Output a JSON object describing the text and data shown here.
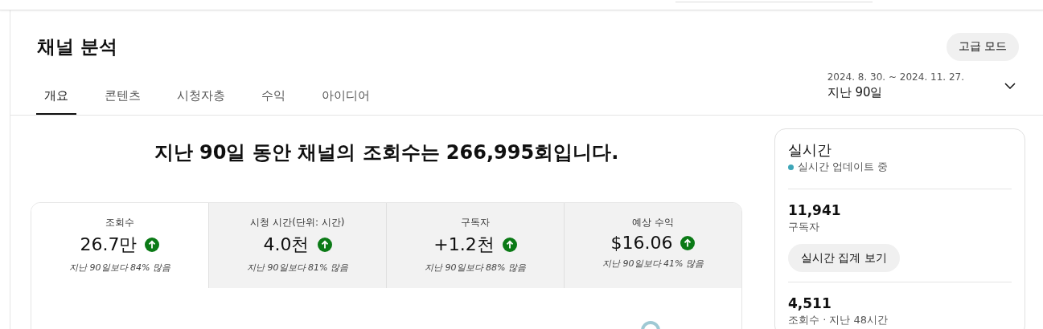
{
  "page_title": "채널 분석",
  "advanced_button": "고급 모드",
  "tabs": [
    {
      "label": "개요",
      "selected": true
    },
    {
      "label": "콘텐츠",
      "selected": false
    },
    {
      "label": "시청자층",
      "selected": false
    },
    {
      "label": "수익",
      "selected": false
    },
    {
      "label": "아이디어",
      "selected": false
    }
  ],
  "date_range": {
    "dates": "2024. 8. 30. ~ 2024. 11. 27.",
    "label": "지난 90일"
  },
  "headline": "지난 90일 동안 채널의 조회수는 266,995회입니다.",
  "metrics": [
    {
      "label": "조회수",
      "value": "26.7만",
      "kind": "up",
      "comparison": "지난 90일보다 84% 많음",
      "selected": true
    },
    {
      "label": "시청 시간(단위: 시간)",
      "value": "4.0천",
      "kind": "up",
      "comparison": "지난 90일보다 81% 많음",
      "selected": false
    },
    {
      "label": "구독자",
      "value": "+1.2천",
      "kind": "up",
      "comparison": "지난 90일보다 88% 많음",
      "selected": false
    },
    {
      "label": "예상 수익",
      "value": "$16.06",
      "kind": "up",
      "comparison": "지난 90일보다 41% 많음",
      "selected": false
    }
  ],
  "realtime": {
    "title": "실시간",
    "status": {
      "text": "실시간 업데이트 중",
      "color": "#3ea6b8"
    },
    "stats": [
      {
        "value": "11,941",
        "label": "구독자",
        "button": "실시간 집계 보기"
      },
      {
        "value": "4,511",
        "label": "조회수 · 지난 48시간"
      }
    ]
  }
}
